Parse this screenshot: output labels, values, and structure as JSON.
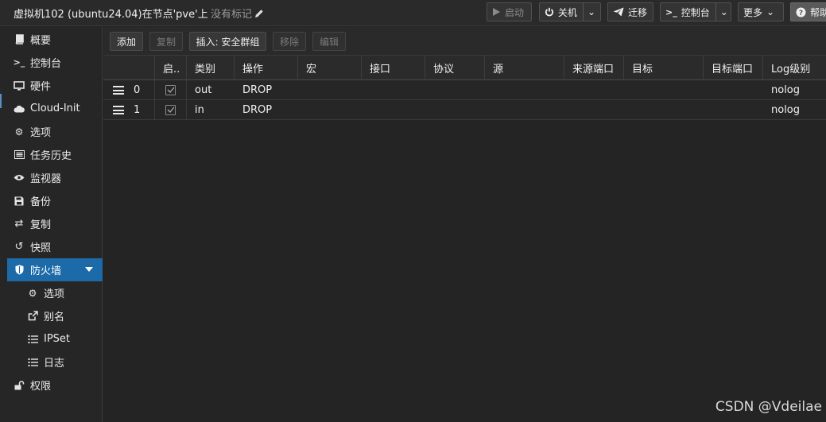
{
  "header": {
    "title": "虚拟机102 (ubuntu24.04)在节点'pve'上",
    "tags_label": "没有标记",
    "buttons": {
      "start": "启动",
      "shutdown": "关机",
      "migrate": "迁移",
      "console": "控制台",
      "more": "更多",
      "help": "帮助"
    }
  },
  "sidebar": {
    "items": [
      {
        "label": "概要",
        "icon": "book-icon"
      },
      {
        "label": "控制台",
        "icon": "terminal-icon"
      },
      {
        "label": "硬件",
        "icon": "desktop-icon"
      },
      {
        "label": "Cloud-Init",
        "icon": "cloud-icon"
      },
      {
        "label": "选项",
        "icon": "gear-icon"
      },
      {
        "label": "任务历史",
        "icon": "list-icon"
      },
      {
        "label": "监视器",
        "icon": "eye-icon"
      },
      {
        "label": "备份",
        "icon": "floppy-icon"
      },
      {
        "label": "复制",
        "icon": "retweet-icon"
      },
      {
        "label": "快照",
        "icon": "history-icon"
      },
      {
        "label": "防火墙",
        "icon": "shield-icon"
      },
      {
        "label": "选项",
        "icon": "gear-icon"
      },
      {
        "label": "别名",
        "icon": "external-link-icon"
      },
      {
        "label": "IPSet",
        "icon": "list-ol-icon"
      },
      {
        "label": "日志",
        "icon": "list-icon"
      },
      {
        "label": "权限",
        "icon": "unlock-icon"
      }
    ]
  },
  "toolbar": {
    "add": "添加",
    "copy": "复制",
    "insert_group": "插入: 安全群组",
    "remove": "移除",
    "edit": "编辑"
  },
  "grid": {
    "columns": [
      "启..",
      "类别",
      "操作",
      "宏",
      "接口",
      "协议",
      "源",
      "来源端口",
      "目标",
      "目标端口",
      "Log级别"
    ],
    "rows": [
      {
        "pos": "0",
        "enabled": true,
        "type": "out",
        "action": "DROP",
        "log": "nolog"
      },
      {
        "pos": "1",
        "enabled": true,
        "type": "in",
        "action": "DROP",
        "log": "nolog"
      }
    ]
  },
  "watermark": "CSDN @Vdeilae"
}
